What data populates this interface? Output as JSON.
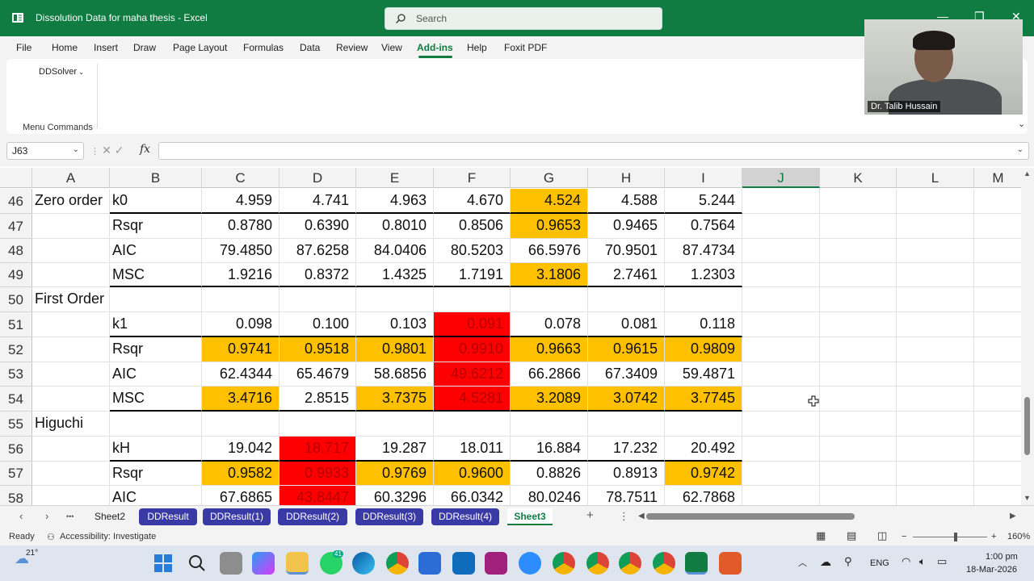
{
  "window": {
    "title": "Dissolution Data for maha thesis  -  Excel",
    "search_placeholder": "Search",
    "minimize": "—",
    "restore": "❐",
    "close": "✕"
  },
  "menu": {
    "items": [
      "File",
      "Home",
      "Insert",
      "Draw",
      "Page Layout",
      "Formulas",
      "Data",
      "Review",
      "View",
      "Add-ins",
      "Help",
      "Foxit PDF"
    ],
    "active": "Add-ins"
  },
  "ribbon": {
    "dropdown": "DDSolver",
    "group_label": "Menu Commands",
    "collapse_glyph": "⌄"
  },
  "formula_bar": {
    "name_box": "J63",
    "fx": "fx",
    "formula": ""
  },
  "columns": [
    "A",
    "B",
    "C",
    "D",
    "E",
    "F",
    "G",
    "H",
    "I",
    "J",
    "K",
    "L",
    "M"
  ],
  "selected_column": "J",
  "rows": [
    {
      "num": "46",
      "a": "Zero order",
      "b": "k0",
      "vals": [
        "4.959",
        "4.741",
        "4.963",
        "4.670",
        "4.524",
        "4.588",
        "5.244"
      ],
      "fill": [
        "",
        "",
        "",
        "",
        "orange",
        "",
        ""
      ]
    },
    {
      "num": "47",
      "a": "",
      "b": "Rsqr",
      "vals": [
        "0.8780",
        "0.6390",
        "0.8010",
        "0.8506",
        "0.9653",
        "0.9465",
        "0.7564"
      ],
      "fill": [
        "",
        "",
        "",
        "",
        "orange",
        "",
        ""
      ]
    },
    {
      "num": "48",
      "a": "",
      "b": "AIC",
      "vals": [
        "79.4850",
        "87.6258",
        "84.0406",
        "80.5203",
        "66.5976",
        "70.9501",
        "87.4734"
      ],
      "fill": [
        "",
        "",
        "",
        "",
        "",
        "",
        ""
      ]
    },
    {
      "num": "49",
      "a": "",
      "b": "MSC",
      "vals": [
        "1.9216",
        "0.8372",
        "1.4325",
        "1.7191",
        "3.1806",
        "2.7461",
        "1.2303"
      ],
      "fill": [
        "",
        "",
        "",
        "",
        "orange",
        "",
        ""
      ]
    },
    {
      "num": "50",
      "a": "First Order",
      "b": "",
      "vals": [
        "",
        "",
        "",
        "",
        "",
        "",
        ""
      ],
      "fill": [
        "",
        "",
        "",
        "",
        "",
        "",
        ""
      ]
    },
    {
      "num": "51",
      "a": "",
      "b": "k1",
      "vals": [
        "0.098",
        "0.100",
        "0.103",
        "0.091",
        "0.078",
        "0.081",
        "0.118"
      ],
      "fill": [
        "",
        "",
        "",
        "red",
        "",
        "",
        ""
      ]
    },
    {
      "num": "52",
      "a": "",
      "b": "Rsqr",
      "vals": [
        "0.9741",
        "0.9518",
        "0.9801",
        "0.9910",
        "0.9663",
        "0.9615",
        "0.9809"
      ],
      "fill": [
        "orange",
        "orange",
        "orange",
        "red",
        "orange",
        "orange",
        "orange"
      ]
    },
    {
      "num": "53",
      "a": "",
      "b": "AIC",
      "vals": [
        "62.4344",
        "65.4679",
        "58.6856",
        "49.6212",
        "66.2866",
        "67.3409",
        "59.4871"
      ],
      "fill": [
        "",
        "",
        "",
        "red",
        "",
        "",
        ""
      ]
    },
    {
      "num": "54",
      "a": "",
      "b": "MSC",
      "vals": [
        "3.4716",
        "2.8515",
        "3.7375",
        "4.5281",
        "3.2089",
        "3.0742",
        "3.7745"
      ],
      "fill": [
        "orange",
        "",
        "orange",
        "red",
        "orange",
        "orange",
        "orange"
      ]
    },
    {
      "num": "55",
      "a": "Higuchi",
      "b": "",
      "vals": [
        "",
        "",
        "",
        "",
        "",
        "",
        ""
      ],
      "fill": [
        "",
        "",
        "",
        "",
        "",
        "",
        ""
      ]
    },
    {
      "num": "56",
      "a": "",
      "b": "kH",
      "vals": [
        "19.042",
        "18.717",
        "19.287",
        "18.011",
        "16.884",
        "17.232",
        "20.492"
      ],
      "fill": [
        "",
        "red",
        "",
        "",
        "",
        "",
        ""
      ]
    },
    {
      "num": "57",
      "a": "",
      "b": "Rsqr",
      "vals": [
        "0.9582",
        "0.9933",
        "0.9769",
        "0.9600",
        "0.8826",
        "0.8913",
        "0.9742"
      ],
      "fill": [
        "orange",
        "red",
        "orange",
        "orange",
        "",
        "",
        "orange"
      ]
    },
    {
      "num": "58",
      "a": "",
      "b": "AIC",
      "vals": [
        "67.6865",
        "43.8447",
        "60.3296",
        "66.0342",
        "80.0246",
        "78.7511",
        "62.7868"
      ],
      "fill": [
        "",
        "red",
        "",
        "",
        "",
        "",
        ""
      ]
    }
  ],
  "sheets": {
    "tabs": [
      "Sheet2",
      "DDResult",
      "DDResult(1)",
      "DDResult(2)",
      "DDResult(3)",
      "DDResult(4)",
      "Sheet3"
    ],
    "active": "Sheet3",
    "add": "+",
    "more": "⋮",
    "ellipsis": "•••"
  },
  "status": {
    "ready": "Ready",
    "accessibility": "Accessibility: Investigate",
    "zoom": "160%",
    "minus": "−",
    "plus": "+"
  },
  "taskbar": {
    "weather": "21°",
    "lang": "ENG",
    "time": "1:00 pm",
    "date": "18-Mar-2026",
    "whatsapp_badge": "41"
  },
  "webcam": {
    "name": "Dr. Talib Hussain"
  }
}
